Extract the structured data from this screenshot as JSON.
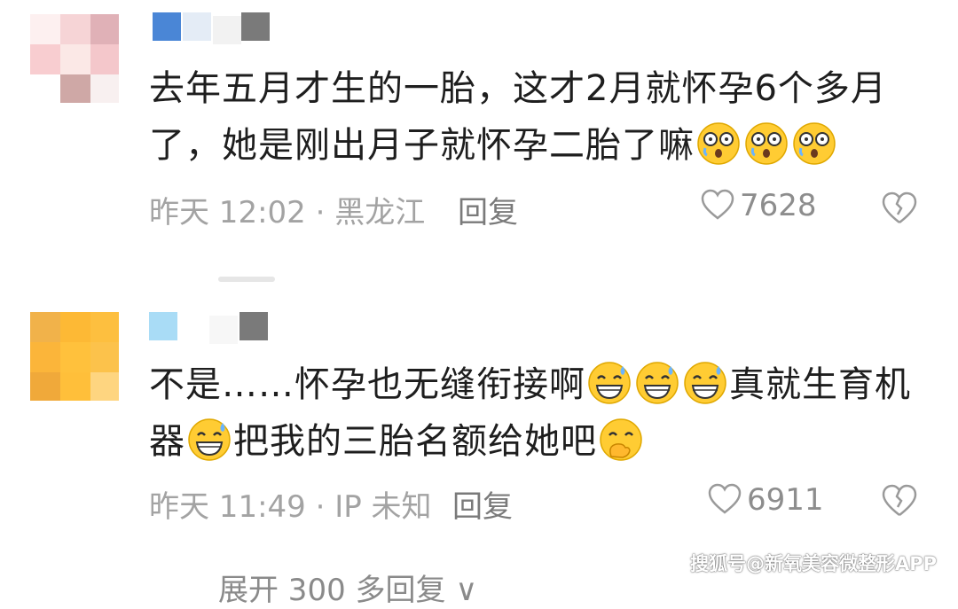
{
  "comments": [
    {
      "text": "去年五月才生的一胎，这才2月就怀孕6个多月了，她是刚出月子就怀孕二胎了嘛",
      "emojis": [
        "dizzy-face-icon",
        "dizzy-face-icon",
        "dizzy-face-icon"
      ],
      "time_location": "昨天 12:02 · 黑龙江",
      "reply_label": "回复",
      "likes": "7628"
    },
    {
      "text_part1": "不是……怀孕也无缝衔接啊",
      "emojis1": [
        "grinning-sweat-icon",
        "grinning-sweat-icon",
        "grinning-sweat-icon"
      ],
      "text_part2": "真就生育机器",
      "emojis2": [
        "grinning-sweat-icon"
      ],
      "text_part3": "把我的三胎名额给她吧",
      "emojis3": [
        "hand-over-mouth-icon"
      ],
      "time_location": "昨天 11:49 · IP 未知",
      "reply_label": "回复",
      "likes": "6911"
    }
  ],
  "expand_replies": "展开 300 多回复 ∨",
  "watermark": "搜狐号@新氧美容微整形APP",
  "colors": {
    "text": "#1e1e1e",
    "meta": "#a3a3a3",
    "emoji_yellow": "#ffcc33"
  }
}
